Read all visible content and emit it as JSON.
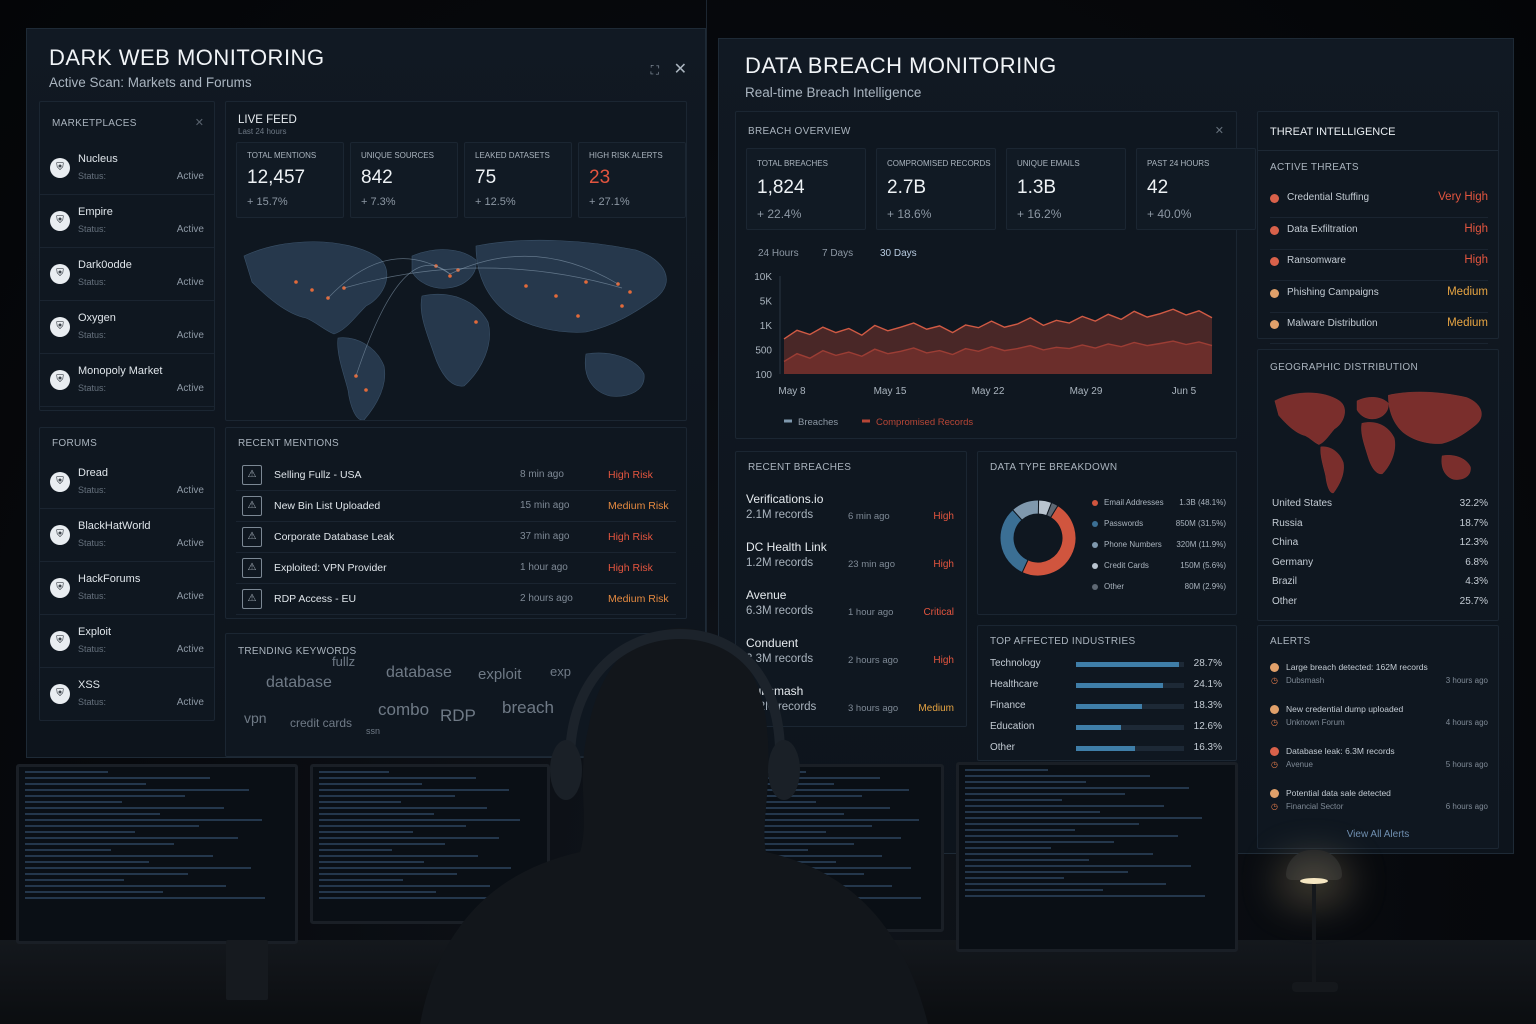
{
  "left_panel": {
    "title": "DARK WEB MONITORING",
    "subtitle": "Active Scan: Markets and Forums",
    "marketplaces": {
      "header": "MARKETPLACES",
      "items": [
        {
          "name": "Nucleus",
          "status_label": "Status:",
          "status": "Active"
        },
        {
          "name": "Empire",
          "status_label": "Status:",
          "status": "Active"
        },
        {
          "name": "Dark0odde",
          "status_label": "Status:",
          "status": "Active"
        },
        {
          "name": "Oxygen",
          "status_label": "Status:",
          "status": "Active"
        },
        {
          "name": "Monopoly Market",
          "status_label": "Status:",
          "status": "Active"
        }
      ]
    },
    "forums": {
      "header": "FORUMS",
      "items": [
        {
          "name": "Dread",
          "status_label": "Status:",
          "status": "Active"
        },
        {
          "name": "BlackHatWorld",
          "status_label": "Status:",
          "status": "Active"
        },
        {
          "name": "HackForums",
          "status_label": "Status:",
          "status": "Active"
        },
        {
          "name": "Exploit",
          "status_label": "Status:",
          "status": "Active"
        },
        {
          "name": "XSS",
          "status_label": "Status:",
          "status": "Active"
        }
      ]
    },
    "live_feed": {
      "header": "LIVE FEED",
      "sub": "Last 24 hours",
      "stats": [
        {
          "label": "TOTAL MENTIONS",
          "value": "12,457",
          "change": "+ 15.7%"
        },
        {
          "label": "UNIQUE SOURCES",
          "value": "842",
          "change": "+ 7.3%"
        },
        {
          "label": "LEAKED DATASETS",
          "value": "75",
          "change": "+ 12.5%"
        },
        {
          "label": "HIGH RISK ALERTS",
          "value": "23",
          "change": "+ 27.1%"
        }
      ]
    },
    "recent_mentions": {
      "header": "RECENT MENTIONS",
      "items": [
        {
          "text": "Selling Fullz - USA",
          "time": "8 min ago",
          "risk": "High Risk"
        },
        {
          "text": "New Bin List Uploaded",
          "time": "15 min ago",
          "risk": "Medium Risk"
        },
        {
          "text": "Corporate Database Leak",
          "time": "37 min ago",
          "risk": "High Risk"
        },
        {
          "text": "Exploited: VPN Provider",
          "time": "1 hour ago",
          "risk": "High Risk"
        },
        {
          "text": "RDP Access - EU",
          "time": "2 hours ago",
          "risk": "Medium Risk"
        }
      ]
    },
    "trending": {
      "header": "TRENDING KEYWORDS",
      "keywords": [
        "fullz",
        "database",
        "database",
        "exploit",
        "exp",
        "vpn",
        "credit cards",
        "combo",
        "RDP",
        "breach",
        "ssn"
      ]
    }
  },
  "right_panel": {
    "title": "DATA BREACH MONITORING",
    "subtitle": "Real-time Breach Intelligence",
    "overview": {
      "header": "BREACH OVERVIEW",
      "stats": [
        {
          "label": "TOTAL BREACHES",
          "value": "1,824",
          "change": "+ 22.4%"
        },
        {
          "label": "COMPROMISED RECORDS",
          "value": "2.7B",
          "change": "+ 18.6%"
        },
        {
          "label": "UNIQUE EMAILS",
          "value": "1.3B",
          "change": "+ 16.2%"
        },
        {
          "label": "PAST 24 HOURS",
          "value": "42",
          "change": "+ 40.0%"
        }
      ],
      "tabs": [
        "24 Hours",
        "7 Days",
        "30 Days"
      ],
      "active_tab": "30 Days"
    },
    "recent_breaches": {
      "header": "RECENT BREACHES",
      "items": [
        {
          "name": "Verifications.io",
          "records": "2.1M records",
          "time": "6 min ago",
          "severity": "High"
        },
        {
          "name": "DC Health Link",
          "records": "1.2M records",
          "time": "23 min ago",
          "severity": "High"
        },
        {
          "name": "Avenue",
          "records": "6.3M records",
          "time": "1 hour ago",
          "severity": "Critical"
        },
        {
          "name": "Conduent",
          "records": "3.3M records",
          "time": "2 hours ago",
          "severity": "High"
        },
        {
          "name": "Dubsmash",
          "records": "162M records",
          "time": "3 hours ago",
          "severity": "Medium"
        }
      ]
    },
    "data_types": {
      "header": "DATA TYPE BREAKDOWN",
      "items": [
        {
          "label": "Email Addresses",
          "value": "1.3B (48.1%)",
          "pct": 48.1,
          "color": "#d0553e"
        },
        {
          "label": "Passwords",
          "value": "850M (31.5%)",
          "pct": 31.5,
          "color": "#3b6f94"
        },
        {
          "label": "Phone Numbers",
          "value": "320M (11.9%)",
          "pct": 11.9,
          "color": "#7f98ad"
        },
        {
          "label": "Credit Cards",
          "value": "150M (5.6%)",
          "pct": 5.6,
          "color": "#b9c4cf"
        },
        {
          "label": "Other",
          "value": "80M (2.9%)",
          "pct": 2.9,
          "color": "#5e6873"
        }
      ]
    },
    "industries": {
      "header": "TOP AFFECTED INDUSTRIES",
      "items": [
        {
          "label": "Technology",
          "value": "28.7%",
          "pct": 28.7
        },
        {
          "label": "Healthcare",
          "value": "24.1%",
          "pct": 24.1
        },
        {
          "label": "Finance",
          "value": "18.3%",
          "pct": 18.3
        },
        {
          "label": "Education",
          "value": "12.6%",
          "pct": 12.6
        },
        {
          "label": "Other",
          "value": "16.3%",
          "pct": 16.3
        }
      ]
    },
    "threat_intel": {
      "header": "THREAT INTELLIGENCE",
      "active_header": "ACTIVE THREATS",
      "items": [
        {
          "label": "Credential Stuffing",
          "level": "Very High"
        },
        {
          "label": "Data Exfiltration",
          "level": "High"
        },
        {
          "label": "Ransomware",
          "level": "High"
        },
        {
          "label": "Phishing Campaigns",
          "level": "Medium"
        },
        {
          "label": "Malware Distribution",
          "level": "Medium"
        }
      ]
    },
    "geo": {
      "header": "GEOGRAPHIC DISTRIBUTION",
      "items": [
        {
          "country": "United States",
          "value": "32.2%"
        },
        {
          "country": "Russia",
          "value": "18.7%"
        },
        {
          "country": "China",
          "value": "12.3%"
        },
        {
          "country": "Germany",
          "value": "6.8%"
        },
        {
          "country": "Brazil",
          "value": "4.3%"
        },
        {
          "country": "Other",
          "value": "25.7%"
        }
      ]
    },
    "alerts": {
      "header": "ALERTS",
      "items": [
        {
          "title": "Large breach detected: 162M records",
          "source": "Dubsmash",
          "time": "3 hours ago"
        },
        {
          "title": "New credential dump uploaded",
          "source": "Unknown Forum",
          "time": "4 hours ago"
        },
        {
          "title": "Database leak: 6.3M records",
          "source": "Avenue",
          "time": "5 hours ago"
        },
        {
          "title": "Potential data sale detected",
          "source": "Financial Sector",
          "time": "6 hours ago"
        }
      ],
      "view_all": "View All Alerts"
    }
  },
  "chart_data": {
    "type": "area",
    "x": [
      "May 8",
      "May 15",
      "May 22",
      "May 29",
      "Jun 5"
    ],
    "ylabels": [
      "10K",
      "5K",
      "1K",
      "500",
      "100"
    ],
    "series": [
      {
        "name": "Breaches",
        "values": [
          520,
          780,
          640,
          900,
          700,
          850,
          620,
          980,
          760,
          900,
          1100,
          820,
          960,
          700,
          1000,
          880,
          1200,
          900,
          1050,
          1400,
          980,
          1250,
          1100,
          1500,
          1200,
          1650,
          1300,
          1900,
          1450,
          1700,
          2100,
          1600,
          1950,
          1400
        ]
      },
      {
        "name": "Compromised Records",
        "values": [
          180,
          260,
          210,
          300,
          240,
          280,
          230,
          320,
          260,
          290,
          340,
          270,
          300,
          250,
          330,
          290,
          360,
          300,
          330,
          380,
          310,
          350,
          330,
          390,
          340,
          410,
          360,
          440,
          380,
          420,
          470,
          400,
          450,
          380
        ]
      }
    ],
    "colors": [
      "#b74636",
      "#6e2e2b"
    ],
    "yscale": "log"
  }
}
